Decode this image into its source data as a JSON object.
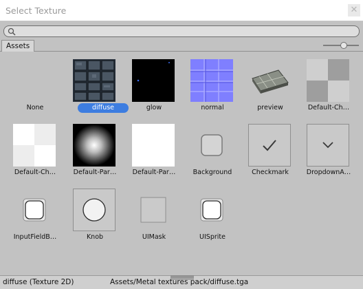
{
  "window": {
    "title": "Select Texture",
    "close_glyph": "✕"
  },
  "search": {
    "placeholder": ""
  },
  "tabs": {
    "assets": "Assets"
  },
  "thumb_size_slider": {
    "level": 0.6
  },
  "items": [
    {
      "label": "None",
      "icon": "none",
      "selected": false
    },
    {
      "label": "diffuse",
      "icon": "stone-tile-texture-icon",
      "selected": true
    },
    {
      "label": "glow",
      "icon": "glow-texture-icon",
      "selected": false
    },
    {
      "label": "normal",
      "icon": "normal-map-texture-icon",
      "selected": false
    },
    {
      "label": "preview",
      "icon": "preview-texture-icon",
      "selected": false
    },
    {
      "label": "Default-Ch…",
      "icon": "checker-texture-icon",
      "selected": false
    },
    {
      "label": "Default-Ch…",
      "icon": "checker-light-texture-icon",
      "selected": false
    },
    {
      "label": "Default-Par…",
      "icon": "particle-texture-icon",
      "selected": false
    },
    {
      "label": "Default-Par…",
      "icon": "white-texture-icon",
      "selected": false
    },
    {
      "label": "Background",
      "icon": "rounded-square-icon",
      "selected": false
    },
    {
      "label": "Checkmark",
      "icon": "checkmark-icon",
      "selected": false
    },
    {
      "label": "DropdownA…",
      "icon": "dropdown-arrow-icon",
      "selected": false
    },
    {
      "label": "InputFieldB…",
      "icon": "input-field-background-icon",
      "selected": false
    },
    {
      "label": "Knob",
      "icon": "knob-icon",
      "selected": false
    },
    {
      "label": "UIMask",
      "icon": "ui-mask-icon",
      "selected": false
    },
    {
      "label": "UISprite",
      "icon": "ui-sprite-icon",
      "selected": false
    }
  ],
  "status": {
    "name": "diffuse (Texture 2D)",
    "path": "Assets/Metal textures pack/diffuse.tga"
  },
  "colors": {
    "background": "#c2c2c2",
    "selection": "#3d7de0",
    "normal_map": "#7f7fff",
    "glow_bg": "#000000"
  }
}
